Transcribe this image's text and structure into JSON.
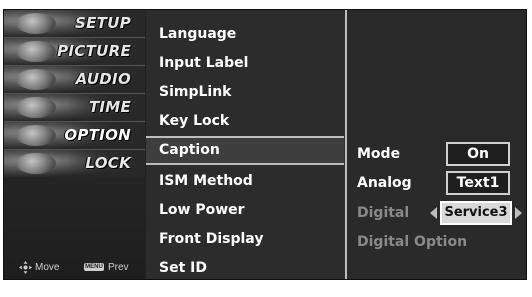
{
  "sidebar": {
    "categories": [
      {
        "label": "SETUP",
        "icon": "satellite-dish-icon"
      },
      {
        "label": "PICTURE",
        "icon": "film-reel-icon"
      },
      {
        "label": "AUDIO",
        "icon": "speaker-icon"
      },
      {
        "label": "TIME",
        "icon": "clock-icon"
      },
      {
        "label": "OPTION",
        "icon": "option-badge-icon"
      },
      {
        "label": "LOCK",
        "icon": "padlock-icon"
      }
    ],
    "active_index": 4
  },
  "footer": {
    "move_label": "Move",
    "menu_key_label": "MENU",
    "prev_label": "Prev"
  },
  "menu": {
    "items": [
      {
        "label": "Language"
      },
      {
        "label": "Input Label"
      },
      {
        "label": "SimpLink"
      },
      {
        "label": "Key Lock"
      },
      {
        "label": "Caption"
      },
      {
        "label": "ISM Method"
      },
      {
        "label": "Low Power"
      },
      {
        "label": "Front Display"
      },
      {
        "label": "Set ID"
      }
    ],
    "selected_index": 4
  },
  "submenu": {
    "mode": {
      "label": "Mode",
      "value": "On"
    },
    "analog": {
      "label": "Analog",
      "value": "Text1"
    },
    "digital": {
      "label": "Digital",
      "value": "Service3"
    },
    "digital_option": {
      "label": "Digital Option"
    }
  },
  "colors": {
    "panel": "#2c2c2c",
    "highlight_border": "#bdbdbd",
    "text": "#ffffff",
    "dim_text": "#8a8a8a"
  }
}
